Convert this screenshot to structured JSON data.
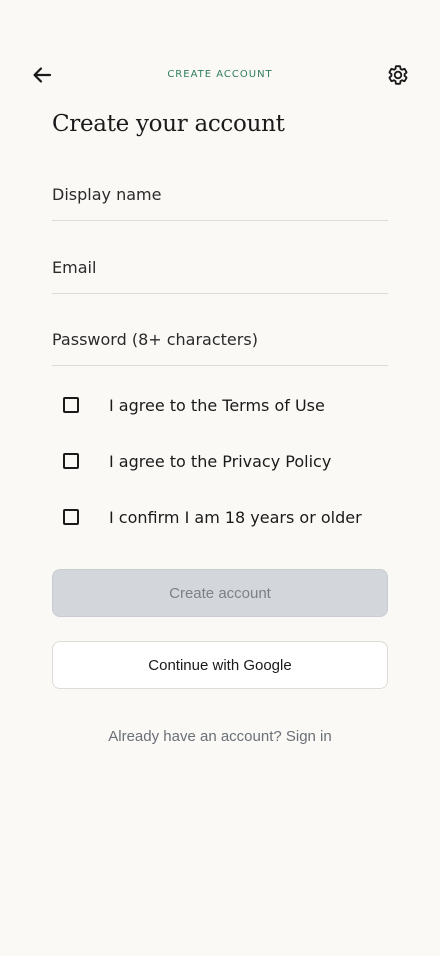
{
  "header": {
    "screen_label": "CREATE ACCOUNT",
    "back_icon": "arrow-left-icon",
    "settings_icon": "gear-icon",
    "accent_color": "#2f7d5b"
  },
  "title": "Create your account",
  "form": {
    "display_name": {
      "placeholder": "Display name",
      "value": ""
    },
    "email": {
      "placeholder": "Email",
      "value": ""
    },
    "password": {
      "placeholder": "Password (8+ characters)",
      "value": ""
    }
  },
  "agreements": [
    {
      "label": "I agree to the Terms of Use",
      "checked": false
    },
    {
      "label": "I agree to the Privacy Policy",
      "checked": false
    },
    {
      "label": "I confirm I am 18 years or older",
      "checked": false
    }
  ],
  "actions": {
    "create_account_label": "Create account",
    "create_account_enabled": false,
    "google_label": "Continue with Google",
    "signin_text": "Already have an account? Sign in"
  }
}
